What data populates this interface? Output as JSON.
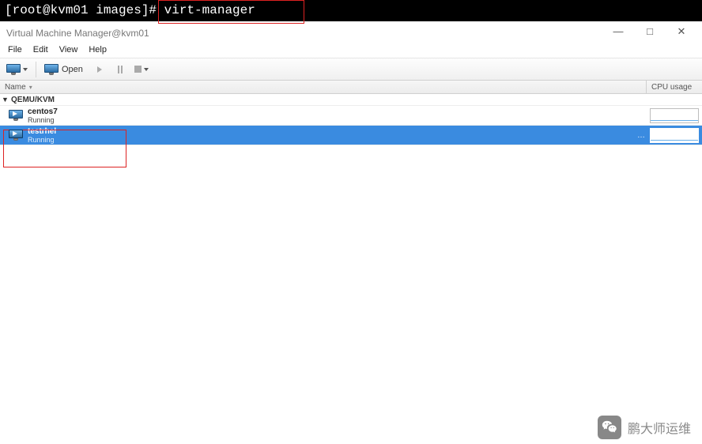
{
  "terminal": {
    "prompt": "[root@kvm01 images]# ",
    "command": "virt-manager"
  },
  "window": {
    "title": "Virtual Machine Manager@kvm01"
  },
  "menu": {
    "file": "File",
    "edit": "Edit",
    "view": "View",
    "help": "Help"
  },
  "toolbar": {
    "open_label": "Open"
  },
  "columns": {
    "name": "Name",
    "cpu": "CPU usage"
  },
  "connection": {
    "label": "QEMU/KVM"
  },
  "vms": [
    {
      "name": "centos7",
      "state": "Running",
      "selected": false
    },
    {
      "name": "testrhel",
      "state": "Running",
      "selected": true
    }
  ],
  "watermark": {
    "text": "鹏大师运维"
  }
}
